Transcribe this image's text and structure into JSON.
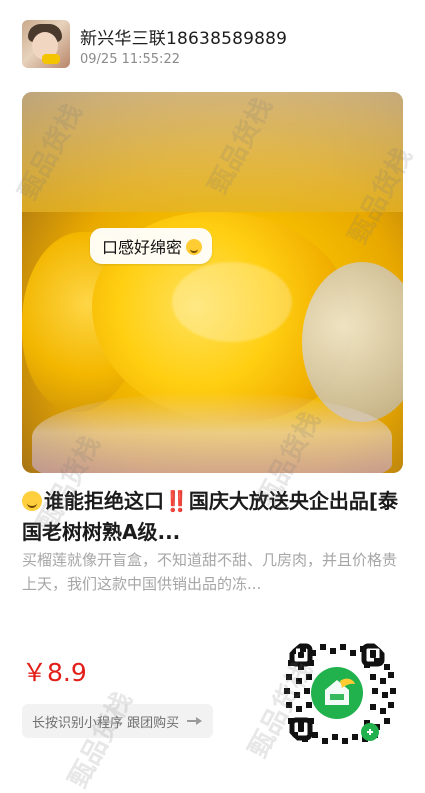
{
  "post": {
    "seller": "新兴华三联18638589889",
    "time": "09/25 11:55:22",
    "image_bubble": "口感好绵密",
    "title_part1": "谁能拒绝这口",
    "title_part2": "‼️",
    "title_part3": "国庆大放送央企出品[泰国老树树熟A级...",
    "description": "买榴莲就像开盲盒，不知道甜不甜、几房肉，并且价格贵上天，我们这款中国供销出品的冻...",
    "price": "￥8.9",
    "miniprogram_button": "长按识别小程序 跟团购买"
  },
  "watermark": {
    "text": "甄品货栈"
  },
  "colors": {
    "price": "#e21f1a",
    "secondary_text": "#a6a6a6",
    "button_bg": "#f2f2f2",
    "qr_green": "#21b24d"
  },
  "icons": {
    "avatar": "child-photo-avatar",
    "qr": "miniprogram-qr-code",
    "arrow": "arrow-right-icon"
  }
}
